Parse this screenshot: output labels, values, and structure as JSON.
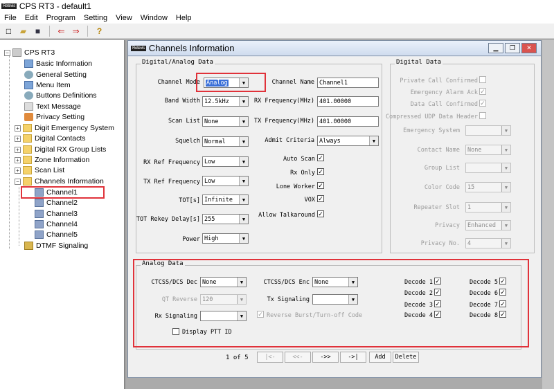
{
  "app": {
    "title": "CPS RT3 - default1",
    "logo": "Retevis"
  },
  "menu": [
    "File",
    "Edit",
    "Program",
    "Setting",
    "View",
    "Window",
    "Help"
  ],
  "tree": {
    "root": "CPS RT3",
    "items": [
      "Basic Information",
      "General Setting",
      "Menu Item",
      "Buttons Definitions",
      "Text Message",
      "Privacy Setting",
      "Digit Emergency System",
      "Digital Contacts",
      "Digital RX Group Lists",
      "Zone Information",
      "Scan List",
      "Channels Information",
      "DTMF Signaling"
    ],
    "channels": [
      "Channel1",
      "Channel2",
      "Channel3",
      "Channel4",
      "Channel5"
    ]
  },
  "window": {
    "title": "Channels Information"
  },
  "digital_analog": {
    "legend": "Digital/Analog Data",
    "channel_mode": {
      "label": "Channel Mode",
      "value": "Analog"
    },
    "band_width": {
      "label": "Band Width",
      "value": "12.5kHz"
    },
    "scan_list": {
      "label": "Scan List",
      "value": "None"
    },
    "squelch": {
      "label": "Squelch",
      "value": "Normal"
    },
    "rx_ref": {
      "label": "RX Ref Frequency",
      "value": "Low"
    },
    "tx_ref": {
      "label": "TX Ref Frequency",
      "value": "Low"
    },
    "tot": {
      "label": "TOT[s]",
      "value": "Infinite"
    },
    "tot_rekey": {
      "label": "TOT Rekey Delay[s]",
      "value": "255"
    },
    "power": {
      "label": "Power",
      "value": "High"
    },
    "channel_name": {
      "label": "Channel Name",
      "value": "Channel1"
    },
    "rx_freq": {
      "label": "RX Frequency(MHz)",
      "value": "401.00000"
    },
    "tx_freq": {
      "label": "TX Frequency(MHz)",
      "value": "401.00000"
    },
    "admit": {
      "label": "Admit Criteria",
      "value": "Always"
    },
    "auto_scan": "Auto Scan",
    "rx_only": "Rx Only",
    "lone_worker": "Lone Worker",
    "vox": "VOX",
    "allow_talkaround": "Allow Talkaround"
  },
  "digital": {
    "legend": "Digital Data",
    "private_call": "Private Call Confirmed",
    "emergency_ack": "Emergency Alarm Ack",
    "data_call": "Data Call Confirmed",
    "compressed_udp": "Compressed UDP Data Header",
    "emergency_system": "Emergency System",
    "contact_name": {
      "label": "Contact Name",
      "value": "None"
    },
    "group_list": "Group List",
    "color_code": {
      "label": "Color Code",
      "value": "15"
    },
    "repeater_slot": {
      "label": "Repeater Slot",
      "value": "1"
    },
    "privacy": {
      "label": "Privacy",
      "value": "Enhanced"
    },
    "privacy_no": {
      "label": "Privacy No.",
      "value": "4"
    }
  },
  "analog": {
    "legend": "Analog Data",
    "ctcss_dec": {
      "label": "CTCSS/DCS Dec",
      "value": "None"
    },
    "ctcss_enc": {
      "label": "CTCSS/DCS Enc",
      "value": "None"
    },
    "qt_reverse": {
      "label": "QT Reverse",
      "value": "120"
    },
    "tx_signaling": "Tx Signaling",
    "rx_signaling": "Rx Signaling",
    "reverse_burst": "Reverse Burst/Turn-off Code",
    "display_ptt": "Display PTT ID",
    "decodes": [
      "Decode 1",
      "Decode 2",
      "Decode 3",
      "Decode 4",
      "Decode 5",
      "Decode 6",
      "Decode 7",
      "Decode 8"
    ]
  },
  "nav": {
    "page": "1 of 5",
    "first": "|<-",
    "prev": "<<-",
    "next": "->>",
    "last": "->|",
    "add": "Add",
    "delete": "Delete"
  }
}
